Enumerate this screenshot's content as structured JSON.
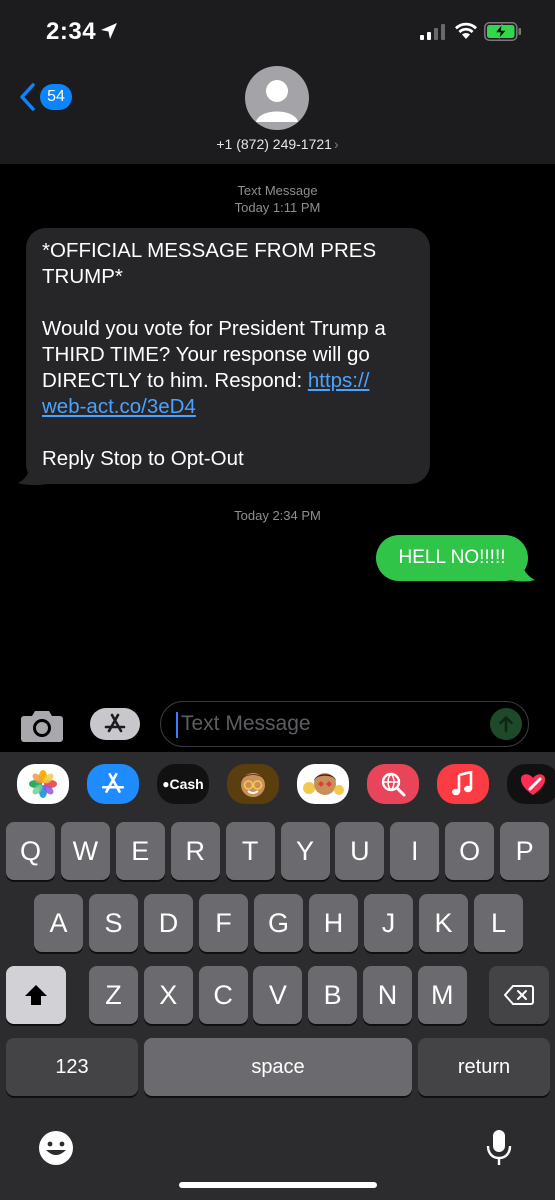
{
  "status_bar": {
    "time": "2:34"
  },
  "header": {
    "back_badge": "54",
    "contact": "+1 (872) 249-1721",
    "chevron": "›"
  },
  "conversation": {
    "meta_label": "Text Message",
    "meta_time": "Today 1:11 PM",
    "incoming": {
      "line1": "*OFFICIAL MESSAGE FROM PRES",
      "line2": "TRUMP*",
      "line3": "Would you vote for President Trump a",
      "line4": "THIRD TIME? Your response will go",
      "line5_text": "DIRECTLY to him. Respond: ",
      "line5_link": "https://",
      "line6_link": "web-act.co/3eD4",
      "line7": "Reply Stop to Opt-Out"
    },
    "time2": "Today 2:34 PM",
    "outgoing": "HELL NO!!!!!"
  },
  "compose": {
    "placeholder": "Text Message"
  },
  "app_strip": [
    {
      "name": "photos-app-icon"
    },
    {
      "name": "app-store-icon"
    },
    {
      "name": "apple-cash-icon",
      "label": "Cash"
    },
    {
      "name": "memoji-icon"
    },
    {
      "name": "memoji-stickers-icon"
    },
    {
      "name": "web-images-icon"
    },
    {
      "name": "music-app-icon"
    },
    {
      "name": "digital-touch-icon"
    }
  ],
  "keyboard": {
    "row1": [
      "Q",
      "W",
      "E",
      "R",
      "T",
      "Y",
      "U",
      "I",
      "O",
      "P"
    ],
    "row2": [
      "A",
      "S",
      "D",
      "F",
      "G",
      "H",
      "J",
      "K",
      "L"
    ],
    "row3": [
      "Z",
      "X",
      "C",
      "V",
      "B",
      "N",
      "M"
    ],
    "numbers": "123",
    "space": "space",
    "return": "return"
  },
  "colors": {
    "incoming_bubble": "#262628",
    "outgoing_bubble": "#30c549",
    "link": "#4ba3ff",
    "accent": "#0a84ff"
  }
}
